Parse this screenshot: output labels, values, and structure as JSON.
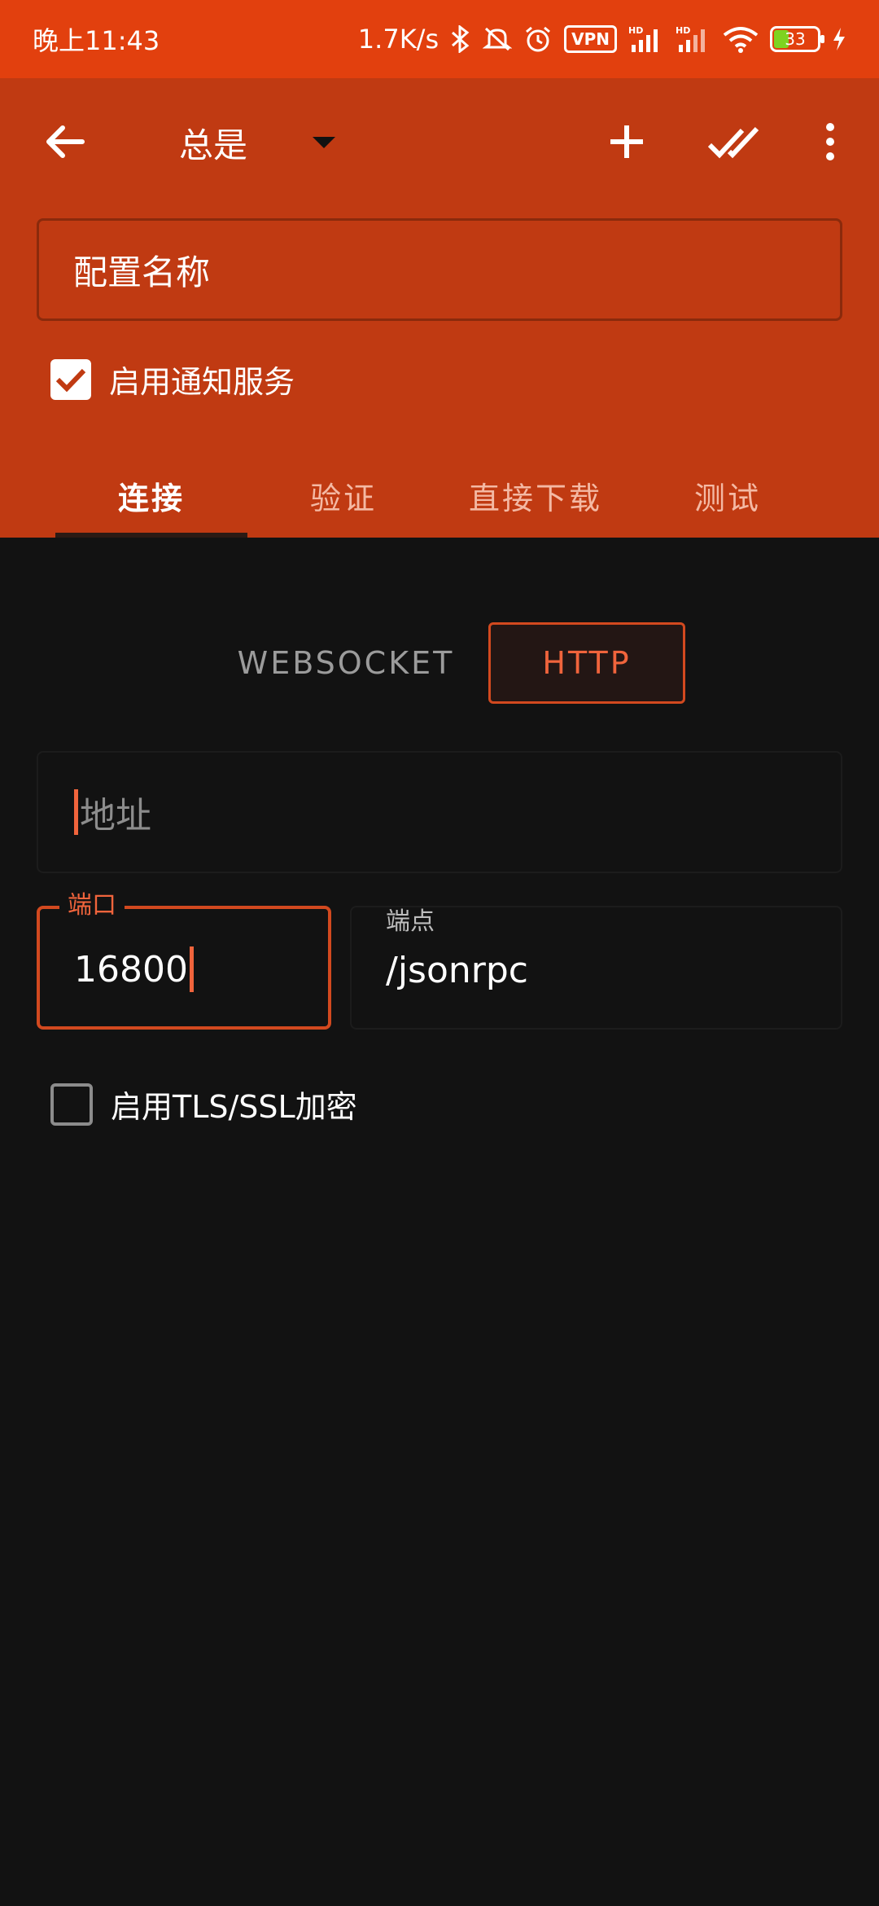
{
  "status_bar": {
    "time": "晚上11:43",
    "net_speed": "1.7K/s",
    "vpn": "VPN",
    "hd1": "HD",
    "hd2": "HD",
    "battery": "33"
  },
  "toolbar": {
    "spinner_value": "总是"
  },
  "profile": {
    "name_value": "配置名称",
    "notify_label": "启用通知服务"
  },
  "tabs": [
    {
      "label": "连接"
    },
    {
      "label": "验证"
    },
    {
      "label": "直接下载"
    },
    {
      "label": "测试"
    }
  ],
  "connection": {
    "protocol_options": [
      "WEBSOCKET",
      "HTTP"
    ],
    "selected_protocol": "HTTP",
    "address_placeholder": "地址",
    "port_label": "端口",
    "port_value": "16800",
    "endpoint_label": "端点",
    "endpoint_value": "/jsonrpc",
    "tls_label": "启用TLS/SSL加密"
  },
  "colors": {
    "status_bar": "#E2400E",
    "app_bar": "#C03A12",
    "accent": "#F0643C",
    "background": "#121212"
  }
}
